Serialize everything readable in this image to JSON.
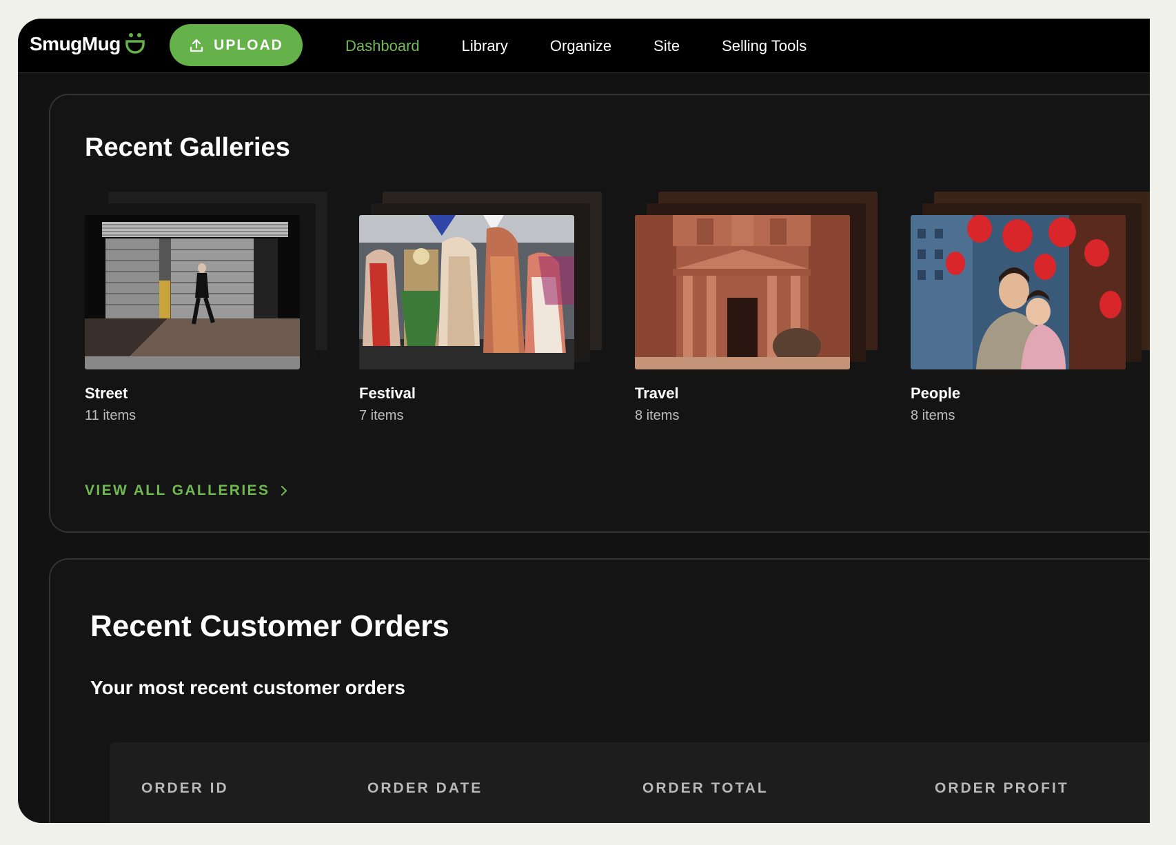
{
  "brand": {
    "name": "SmugMug",
    "accent": "#65b24b"
  },
  "toolbar": {
    "upload_label": "UPLOAD"
  },
  "nav": [
    {
      "label": "Dashboard",
      "active": true
    },
    {
      "label": "Library",
      "active": false
    },
    {
      "label": "Organize",
      "active": false
    },
    {
      "label": "Site",
      "active": false
    },
    {
      "label": "Selling Tools",
      "active": false
    }
  ],
  "recent_galleries": {
    "title": "Recent Galleries",
    "items": [
      {
        "name": "Street",
        "count": "11 items"
      },
      {
        "name": "Festival",
        "count": "7 items"
      },
      {
        "name": "Travel",
        "count": "8 items"
      },
      {
        "name": "People",
        "count": "8 items"
      }
    ],
    "view_all": "VIEW ALL GALLERIES"
  },
  "recent_orders": {
    "title": "Recent Customer Orders",
    "subtitle": "Your most recent customer orders",
    "columns": [
      "ORDER ID",
      "ORDER DATE",
      "ORDER TOTAL",
      "ORDER PROFIT"
    ]
  }
}
